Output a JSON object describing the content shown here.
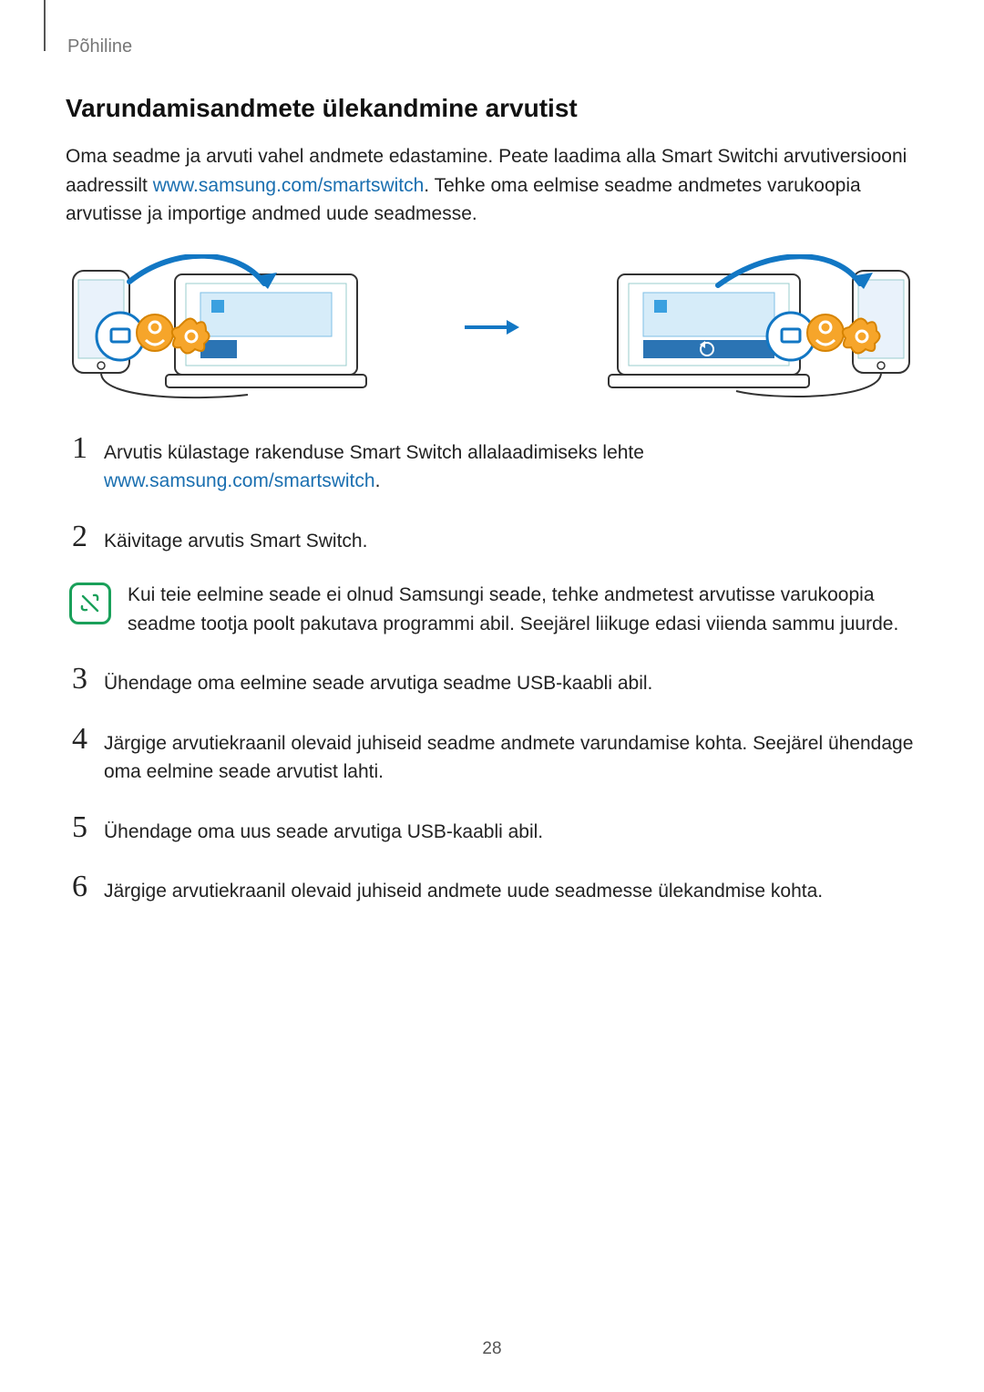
{
  "header": {
    "breadcrumb": "Põhiline"
  },
  "section": {
    "title": "Varundamisandmete ülekandmine arvutist",
    "intro_before_link": "Oma seadme ja arvuti vahel andmete edastamine. Peate laadima alla Smart Switchi arvutiversiooni aadressilt ",
    "intro_link": "www.samsung.com/smartswitch",
    "intro_after_link": ". Tehke oma eelmise seadme andmetes varukoopia arvutisse ja importige andmed uude seadmesse."
  },
  "steps": [
    {
      "n": "1",
      "text_before_link": "Arvutis külastage rakenduse Smart Switch allalaadimiseks lehte ",
      "link": "www.samsung.com/smartswitch",
      "text_after_link": "."
    },
    {
      "n": "2",
      "text": "Käivitage arvutis Smart Switch."
    },
    {
      "n": "3",
      "text": "Ühendage oma eelmine seade arvutiga seadme USB-kaabli abil."
    },
    {
      "n": "4",
      "text": "Järgige arvutiekraanil olevaid juhiseid seadme andmete varundamise kohta. Seejärel ühendage oma eelmine seade arvutist lahti."
    },
    {
      "n": "5",
      "text": "Ühendage oma uus seade arvutiga USB-kaabli abil."
    },
    {
      "n": "6",
      "text": "Järgige arvutiekraanil olevaid juhiseid andmete uude seadmesse ülekandmise kohta."
    }
  ],
  "note": {
    "text": "Kui teie eelmine seade ei olnud Samsungi seade, tehke andmetest arvutisse varukoopia seadme tootja poolt pakutava programmi abil. Seejärel liikuge edasi viienda sammu juurde."
  },
  "page_number": "28"
}
